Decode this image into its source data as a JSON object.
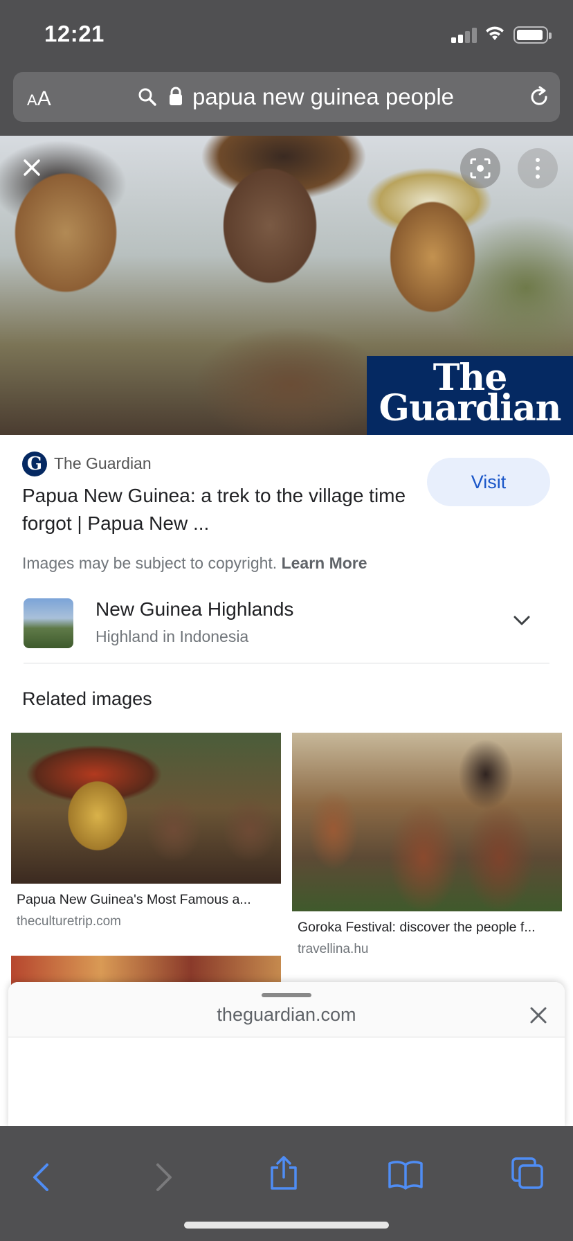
{
  "status_bar": {
    "time": "12:21"
  },
  "address_bar": {
    "text_size_label": "AA",
    "query": "papua new guinea people"
  },
  "preview": {
    "badge_line1": "The",
    "badge_line2": "Guardian",
    "source_logo_letter": "G",
    "source_name": "The Guardian",
    "visit_label": "Visit",
    "title": "Papua New Guinea: a trek to the village time forgot | Papua New ...",
    "copyright_text": "Images may be subject to copyright.",
    "learn_more": "Learn More"
  },
  "entity": {
    "name": "New Guinea Highlands",
    "subtitle": "Highland in Indonesia"
  },
  "related": {
    "heading": "Related images",
    "items": [
      {
        "caption": "Papua New Guinea's Most Famous a...",
        "source": "theculturetrip.com"
      },
      {
        "caption": "Goroka Festival: discover the people f...",
        "source": "travellina.hu"
      }
    ]
  },
  "sheet": {
    "domain": "theguardian.com"
  },
  "icons": [
    "search-icon",
    "lock-icon",
    "reload-icon",
    "close-icon",
    "lens-icon",
    "more-vert-icon",
    "chevron-down-icon",
    "back-icon",
    "forward-icon",
    "share-icon",
    "bookmarks-icon",
    "tabs-icon"
  ],
  "colors": {
    "accent": "#1a56c8",
    "guardian_blue": "#052962",
    "chrome": "#505052"
  }
}
